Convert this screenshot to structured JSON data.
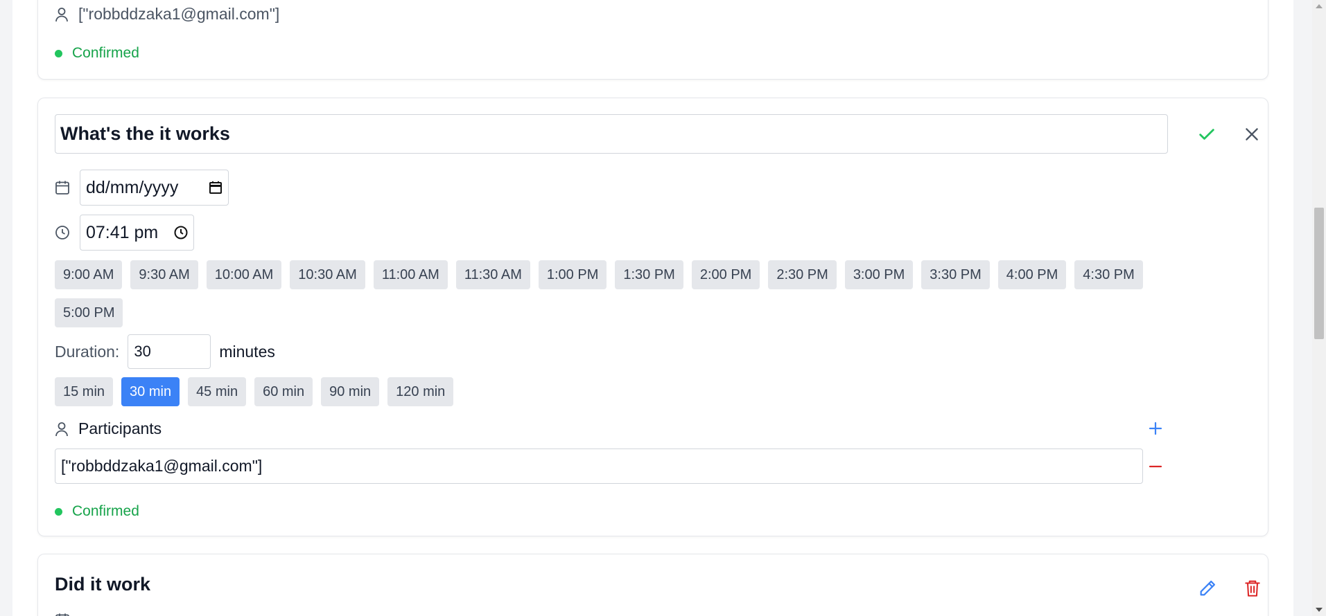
{
  "prev_card": {
    "participant": "[\"robbddzaka1@gmail.com\"]",
    "status": "Confirmed"
  },
  "edit_card": {
    "title_value": "What's the it works",
    "date_value": "dd/mm/yyyy",
    "time_value": "07:41 pm",
    "time_slots": [
      "9:00 AM",
      "9:30 AM",
      "10:00 AM",
      "10:30 AM",
      "11:00 AM",
      "11:30 AM",
      "1:00 PM",
      "1:30 PM",
      "2:00 PM",
      "2:30 PM",
      "3:00 PM",
      "3:30 PM",
      "4:00 PM",
      "4:30 PM",
      "5:00 PM"
    ],
    "duration_label": "Duration:",
    "duration_value": "30",
    "duration_unit": "minutes",
    "duration_options": [
      "15 min",
      "30 min",
      "45 min",
      "60 min",
      "90 min",
      "120 min"
    ],
    "duration_selected": "30 min",
    "participants_label": "Participants",
    "participant_value": "[\"robbddzaka1@gmail.com\"]",
    "status": "Confirmed"
  },
  "next_card": {
    "title": "Did it work"
  },
  "colors": {
    "accent": "#3b82f6",
    "confirm": "#22c55e",
    "danger": "#dc2626",
    "status_text": "#16a34a"
  },
  "icons": {
    "user": "user-icon",
    "calendar": "calendar-icon",
    "clock": "clock-icon",
    "check": "check-icon",
    "close": "close-icon",
    "plus": "plus-icon",
    "minus": "minus-icon",
    "edit": "pencil-icon",
    "delete": "trash-icon"
  }
}
